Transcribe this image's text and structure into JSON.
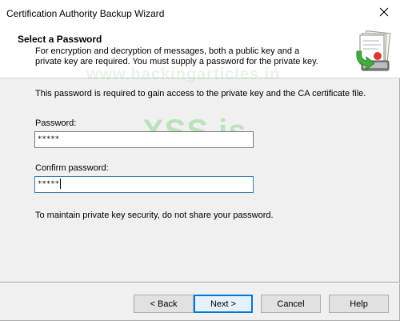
{
  "window": {
    "title": "Certification Authority Backup Wizard"
  },
  "header": {
    "title": "Select a Password",
    "description": "For encryption and decryption of messages, both a public key and a private key are required. You must supply a password for the private key."
  },
  "watermark": {
    "url": "www.hackingarticles.in",
    "brand": "XSS.is"
  },
  "body": {
    "intro": "This password is required to gain access to the private key and the CA certificate file.",
    "password_label": "Password:",
    "password_value": "*****",
    "confirm_label": "Confirm password:",
    "confirm_value": "*****",
    "security_note": "To maintain private key security, do not share your password."
  },
  "buttons": {
    "back": "< Back",
    "next": "Next >",
    "cancel": "Cancel",
    "help": "Help"
  },
  "icons": {
    "header": "certificate-backup-icon",
    "close": "close-icon"
  }
}
